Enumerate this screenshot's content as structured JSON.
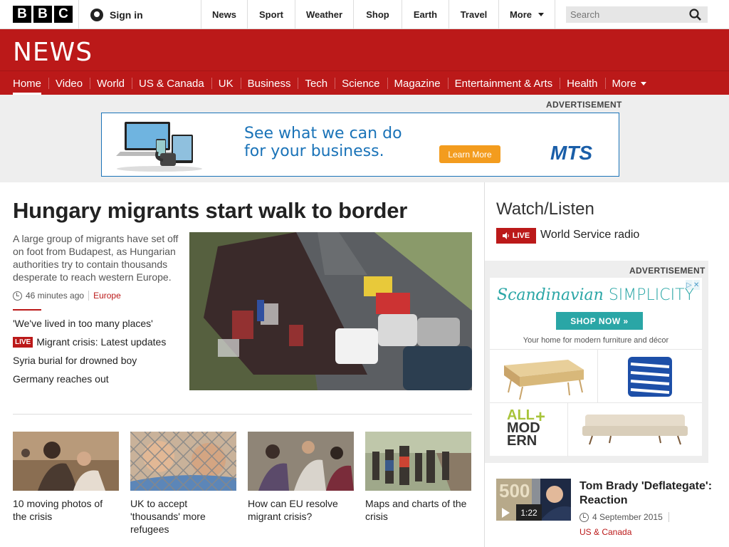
{
  "top": {
    "logo_letters": [
      "B",
      "B",
      "C"
    ],
    "signin_label": "Sign in",
    "nav": [
      "News",
      "Sport",
      "Weather",
      "Shop",
      "Earth",
      "Travel",
      "More"
    ],
    "search_placeholder": "Search"
  },
  "brand": {
    "wordmark": "NEWS",
    "color": "#bb1919"
  },
  "mainnav": [
    "Home",
    "Video",
    "World",
    "US & Canada",
    "UK",
    "Business",
    "Tech",
    "Science",
    "Magazine",
    "Entertainment & Arts",
    "Health",
    "More"
  ],
  "ad_top": {
    "label": "ADVERTISEMENT",
    "headline_line1": "See what we can do",
    "headline_line2": "for your business.",
    "button": "Learn More",
    "logo": "MTS"
  },
  "lead": {
    "headline": "Hungary migrants start walk to border",
    "summary": "A large group of migrants have set off on foot from Budapest, as Hungarian authorities try to contain thousands desperate to reach western Europe.",
    "time": "46 minutes ago",
    "region": "Europe",
    "related": [
      {
        "label": "'We've lived in too many places'",
        "live": ""
      },
      {
        "label": "Migrant crisis: Latest updates",
        "live": "LIVE"
      },
      {
        "label": "Syria burial for drowned boy",
        "live": ""
      },
      {
        "label": "Germany reaches out",
        "live": ""
      }
    ]
  },
  "thumbs": [
    "10 moving photos of the crisis",
    "UK to accept 'thousands' more refugees",
    "How can EU resolve migrant crisis?",
    "Maps and charts of the crisis"
  ],
  "watch": {
    "title": "Watch/Listen",
    "live_label": "LIVE",
    "radio": "World Service radio"
  },
  "ad_side": {
    "label": "ADVERTISEMENT",
    "head_script": "Scandinavian",
    "head_plain": "SIMPLICITY",
    "button": "SHOP NOW »",
    "sub": "Your home for modern furniture and décor",
    "all_modern": [
      "ALL",
      "MOD",
      "ERN"
    ]
  },
  "video": {
    "title": "Tom Brady 'Deflategate': Reaction",
    "duration": "1:22",
    "date": "4 September 2015",
    "region": "US & Canada",
    "thumb_text": "500"
  }
}
